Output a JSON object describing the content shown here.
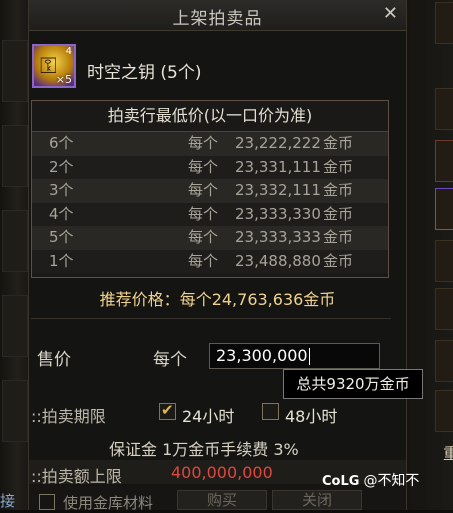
{
  "dialog": {
    "title": "上架拍卖品",
    "close_icon": "close-icon"
  },
  "item": {
    "icon": "golden-key-icon",
    "stack_top": "4",
    "stack_bottom": "×5",
    "name": "时空之钥 (5个)"
  },
  "price_table": {
    "title": "拍卖行最低价(以一口价为准)",
    "rows": [
      {
        "qty": "6个",
        "per": "每个",
        "price": "23,222,222",
        "unit": "金币"
      },
      {
        "qty": "2个",
        "per": "每个",
        "price": "23,331,111",
        "unit": "金币"
      },
      {
        "qty": "3个",
        "per": "每个",
        "price": "23,332,111",
        "unit": "金币"
      },
      {
        "qty": "4个",
        "per": "每个",
        "price": "23,333,330",
        "unit": "金币"
      },
      {
        "qty": "5个",
        "per": "每个",
        "price": "23,333,333",
        "unit": "金币"
      },
      {
        "qty": "1个",
        "per": "每个",
        "price": "23,488,880",
        "unit": "金币"
      }
    ]
  },
  "recommend": {
    "label": "推荐价格：",
    "value": "每个24,763,636金币"
  },
  "sell": {
    "label": "售价",
    "per": "每个",
    "value": "23,300,000"
  },
  "tooltip": {
    "text": "总共9320万金币"
  },
  "period": {
    "label": "::拍卖期限",
    "option_24": "24小时",
    "option_48": "48小时",
    "checked": "24小时"
  },
  "deposit": {
    "text": "保证金 1万金币手续费 3%"
  },
  "limit": {
    "label": "::拍卖额上限",
    "value": "400,000,000"
  },
  "bottom": {
    "left_char": "接",
    "use_label": "使用金库材料",
    "btn_buy": "购买",
    "btn_close": "关闭"
  },
  "watermark": {
    "brand": "CoLG",
    "text": "@不知不"
  },
  "side": {
    "right_char": "重"
  }
}
